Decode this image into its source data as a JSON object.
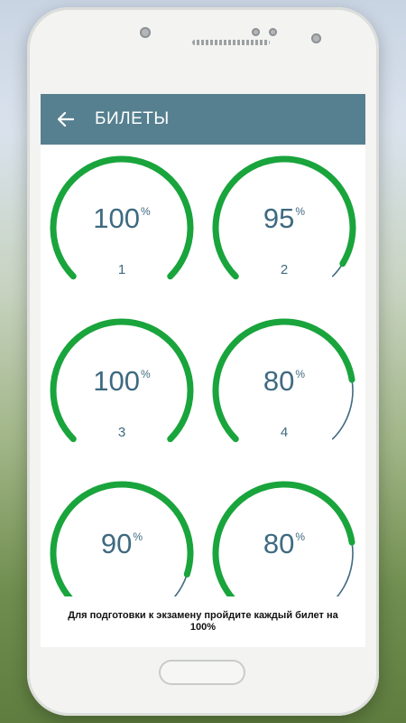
{
  "header": {
    "title": "БИЛЕТЫ",
    "back_icon": "arrow-back-icon"
  },
  "colors": {
    "appbar": "#56808f",
    "progress": "#19a43c",
    "remainder": "#3f6a80",
    "text": "#3f6a80"
  },
  "tickets": [
    {
      "number": "1",
      "percent": 100,
      "percent_text": "100",
      "suffix": "%"
    },
    {
      "number": "2",
      "percent": 95,
      "percent_text": "95",
      "suffix": "%"
    },
    {
      "number": "3",
      "percent": 100,
      "percent_text": "100",
      "suffix": "%"
    },
    {
      "number": "4",
      "percent": 80,
      "percent_text": "80",
      "suffix": "%"
    },
    {
      "number": "",
      "percent": 90,
      "percent_text": "90",
      "suffix": "%"
    },
    {
      "number": "",
      "percent": 80,
      "percent_text": "80",
      "suffix": "%"
    }
  ],
  "footer": {
    "text": "Для подготовки к экзамену пройдите каждый билет на 100%"
  }
}
